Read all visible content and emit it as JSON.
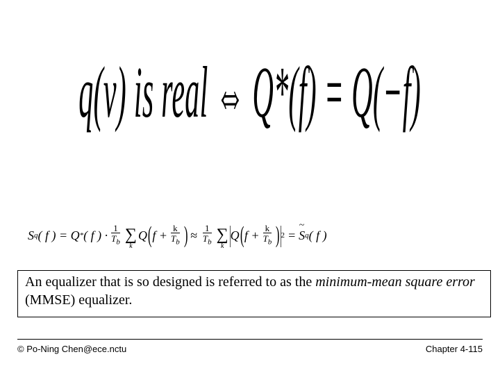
{
  "big_equation": {
    "display": "q(v) is real ⇔ Q*(f) = Q(−f)"
  },
  "small_equation": {
    "lhs_S": "S",
    "lhs_sub": "q",
    "lhs_arg": "( f ) = Q",
    "star": "*",
    "qf": "( f ) ·",
    "frac1_num": "1",
    "frac1_den": "T_b",
    "sum": "∑",
    "sum_sub": "k",
    "Q2": "Q",
    "arg_inner_f": "f +",
    "frac2_num": "k",
    "frac2_den": "T_b",
    "approx": "≈",
    "frac3_num": "1",
    "frac3_den": "T_b",
    "sum2": "∑",
    "sum2_sub": "k",
    "Q3": "Q",
    "sq": "2",
    "eq": "=",
    "Stilde": "S",
    "Stilde_sub": "q",
    "rhs_arg": "( f )"
  },
  "box": {
    "line1a": "An equalizer that is so designed is referred to as the ",
    "ital": "minimum-mean square error",
    "line2b": " (MMSE) equalizer."
  },
  "footer": {
    "left": "© Po-Ning Chen@ece.nctu",
    "right": "Chapter 4-115"
  }
}
